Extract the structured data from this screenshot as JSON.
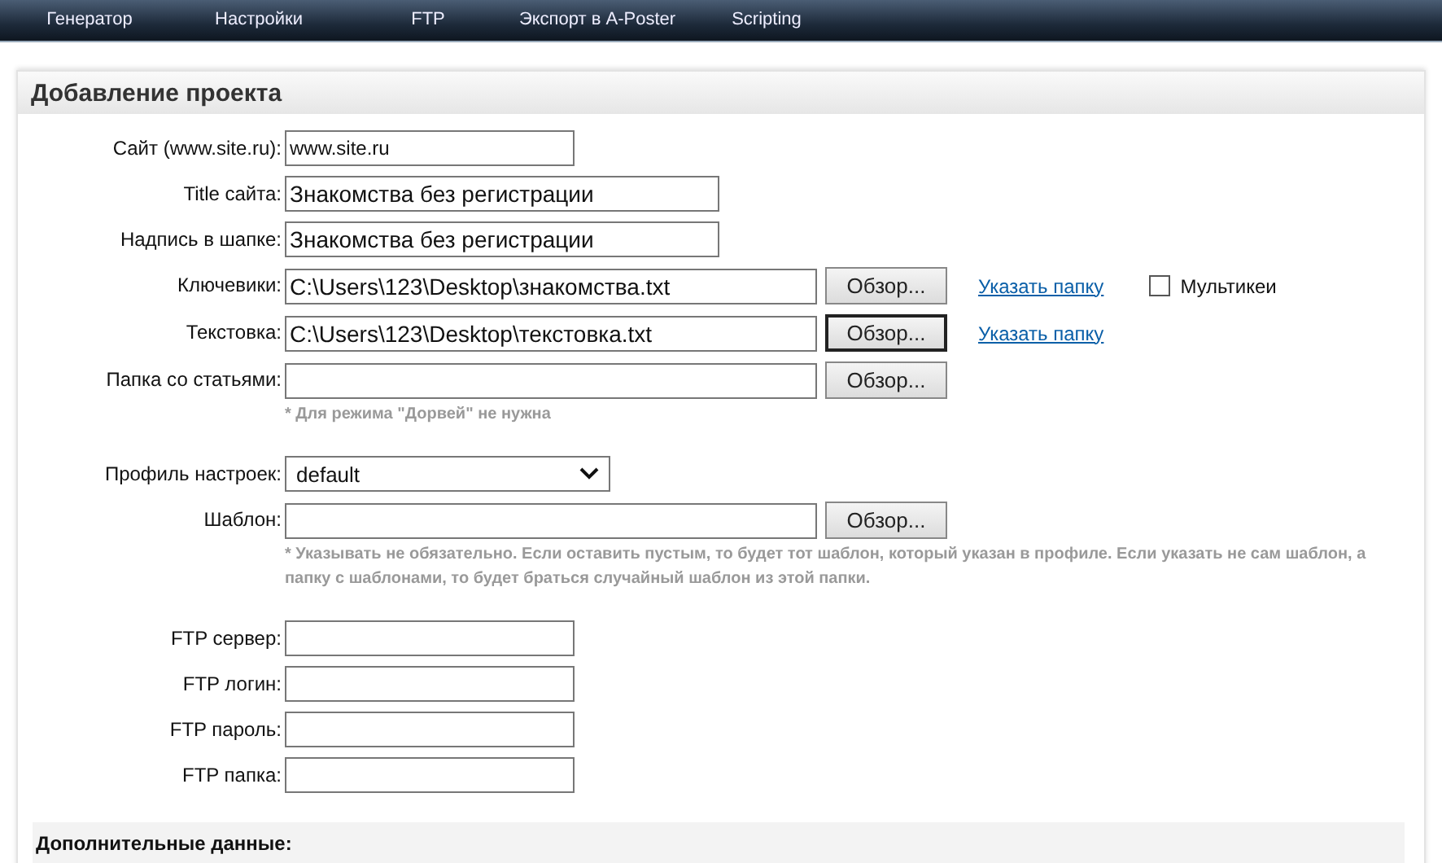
{
  "nav": [
    {
      "label": "Генератор"
    },
    {
      "label": "Настройки"
    },
    {
      "label": "FTP"
    },
    {
      "label": "Экспорт в A-Poster"
    },
    {
      "label": "Scripting"
    }
  ],
  "panel": {
    "title": "Добавление проекта",
    "groups": [
      {
        "rows": [
          {
            "label": "Сайт (www.site.ru):",
            "kind": "short",
            "value": "www.site.ru"
          },
          {
            "label": "Title сайта:",
            "kind": "long",
            "value": "Знакомства без регистрации"
          },
          {
            "label": "Надпись в шапке:",
            "kind": "long",
            "value": "Знакомства без регистрации"
          },
          {
            "label": "Ключевики:",
            "kind": "file",
            "value": "C:\\Users\\123\\Desktop\\знакомства.txt",
            "button": {
              "label": "Обзор...",
              "focused": false
            },
            "link": "Указать папку",
            "checkbox": {
              "label": "Мультикеи",
              "checked": false
            }
          },
          {
            "label": "Текстовка:",
            "kind": "file",
            "value": "C:\\Users\\123\\Desktop\\текстовка.txt",
            "button": {
              "label": "Обзор...",
              "focused": true
            },
            "link": "Указать папку"
          },
          {
            "label": "Папка со статьями:",
            "kind": "file",
            "button": {
              "label": "Обзор...",
              "focused": false
            },
            "hint": "* Для режима \"Дорвей\" не нужна"
          }
        ]
      },
      {
        "rows": [
          {
            "label": "Профиль настроек:",
            "kind": "select",
            "value": "default"
          },
          {
            "label": "Шаблон:",
            "kind": "file",
            "button": {
              "label": "Обзор...",
              "focused": false
            },
            "hint": "* Указывать не обязательно. Если оставить пустым, то будет тот шаблон, который указан в профиле. Если указать не сам шаблон, а папку с шаблонами, то будет браться случайный шаблон из этой папки."
          }
        ]
      },
      {
        "rows": [
          {
            "label": "FTP сервер:",
            "kind": "short"
          },
          {
            "label": "FTP логин:",
            "kind": "short"
          },
          {
            "label": "FTP пароль:",
            "kind": "short"
          },
          {
            "label": "FTP папка:",
            "kind": "short"
          }
        ]
      }
    ],
    "extra_title": "Дополнительные данные:"
  }
}
